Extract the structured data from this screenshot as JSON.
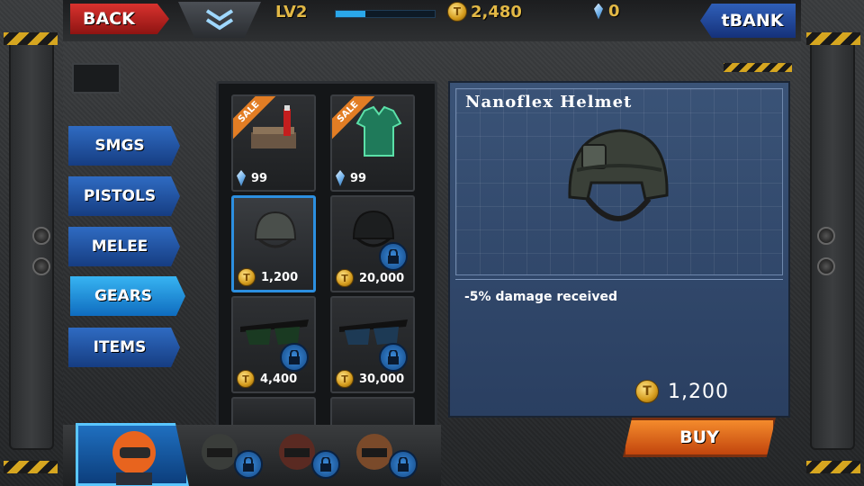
{
  "topbar": {
    "back_label": "BACK",
    "level": "LV2",
    "xp_fraction": 0.3,
    "gold": "2,480",
    "gems": "0",
    "tbank_label": "tBANK"
  },
  "categories": [
    {
      "label": "SMGS",
      "active": false
    },
    {
      "label": "PISTOLS",
      "active": false
    },
    {
      "label": "MELEE",
      "active": false
    },
    {
      "label": "GEARS",
      "active": true
    },
    {
      "label": "ITEMS",
      "active": false
    }
  ],
  "items": [
    {
      "price": "99",
      "currency": "gem",
      "sale_label": "SALE",
      "icon": "medkit-icon",
      "locked": false,
      "selected": false
    },
    {
      "price": "99",
      "currency": "gem",
      "sale_label": "SALE",
      "icon": "armor-vest-icon",
      "locked": false,
      "selected": false
    },
    {
      "price": "1,200",
      "currency": "gold",
      "sale_label": "",
      "icon": "helmet-icon",
      "locked": false,
      "selected": true
    },
    {
      "price": "20,000",
      "currency": "gold",
      "sale_label": "",
      "icon": "helmet-icon",
      "locked": true,
      "selected": false
    },
    {
      "price": "4,400",
      "currency": "gold",
      "sale_label": "",
      "icon": "goggles-icon",
      "locked": true,
      "selected": false
    },
    {
      "price": "30,000",
      "currency": "gold",
      "sale_label": "",
      "icon": "goggles-icon",
      "locked": true,
      "selected": false
    }
  ],
  "detail": {
    "name": "Nanoflex Helmet",
    "description": "-5% damage received",
    "price": "1,200"
  },
  "buy_label": "BUY",
  "characters": [
    {
      "icon": "hero-portrait-icon",
      "locked": false,
      "active": true
    },
    {
      "icon": "character-portrait-icon",
      "locked": true,
      "active": false
    },
    {
      "icon": "character-portrait-icon",
      "locked": true,
      "active": false
    },
    {
      "icon": "character-portrait-icon",
      "locked": true,
      "active": false
    }
  ],
  "colors": {
    "accent_blue": "#2c8fe0",
    "gold_text": "#e2b845",
    "buy_orange": "#f48b2c",
    "back_red": "#d8322e",
    "sale_orange": "#e27d24"
  }
}
